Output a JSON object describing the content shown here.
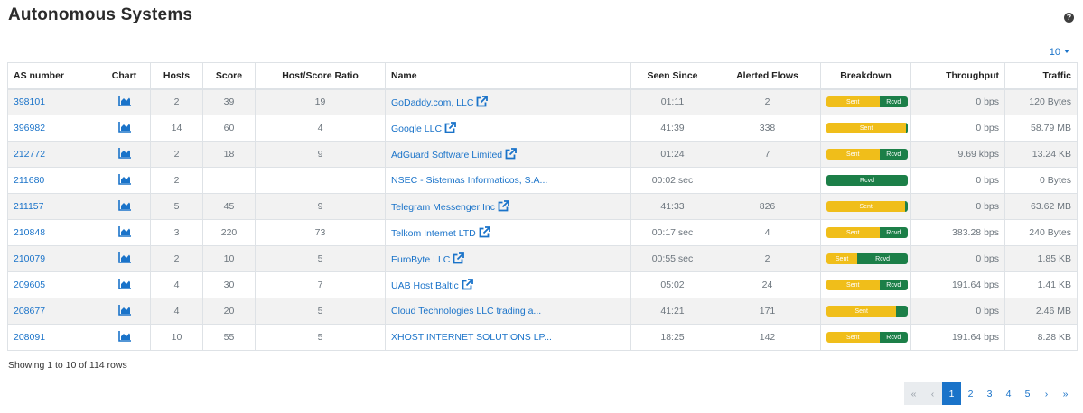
{
  "page": {
    "title": "Autonomous Systems",
    "help_icon": "question-circle-icon",
    "help_glyph": "?"
  },
  "page_size": {
    "value": "10"
  },
  "columns": {
    "as_number": "AS number",
    "chart": "Chart",
    "hosts": "Hosts",
    "score": "Score",
    "ratio": "Host/Score Ratio",
    "name": "Name",
    "seen_since": "Seen Since",
    "alerted_flows": "Alerted Flows",
    "breakdown": "Breakdown",
    "throughput": "Throughput",
    "traffic": "Traffic"
  },
  "colors": {
    "link": "#1a73c9",
    "sent": "#f0be1a",
    "rcvd": "#1c7f48",
    "chart_icon": "#1a73c9"
  },
  "breakdown_labels": {
    "sent": "Sent",
    "rcvd": "Rcvd"
  },
  "rows": [
    {
      "as_number": "398101",
      "hosts": "2",
      "score": "39",
      "ratio": "19",
      "name": "GoDaddy.com, LLC",
      "external": true,
      "seen_since": "01:11",
      "alerted_flows": "2",
      "sent_pct": 65,
      "throughput": "0 bps",
      "traffic": "120 Bytes"
    },
    {
      "as_number": "396982",
      "hosts": "14",
      "score": "60",
      "ratio": "4",
      "name": "Google LLC",
      "external": true,
      "seen_since": "41:39",
      "alerted_flows": "338",
      "sent_pct": 98,
      "throughput": "0 bps",
      "traffic": "58.79 MB"
    },
    {
      "as_number": "212772",
      "hosts": "2",
      "score": "18",
      "ratio": "9",
      "name": "AdGuard Software Limited",
      "external": true,
      "seen_since": "01:24",
      "alerted_flows": "7",
      "sent_pct": 65,
      "throughput": "9.69 kbps",
      "traffic": "13.24 KB"
    },
    {
      "as_number": "211680",
      "hosts": "2",
      "score": "",
      "ratio": "",
      "name": "NSEC - Sistemas Informaticos, S.A...",
      "external": false,
      "seen_since": "00:02 sec",
      "alerted_flows": "",
      "sent_pct": 0,
      "throughput": "0 bps",
      "traffic": "0 Bytes"
    },
    {
      "as_number": "211157",
      "hosts": "5",
      "score": "45",
      "ratio": "9",
      "name": "Telegram Messenger Inc",
      "external": true,
      "seen_since": "41:33",
      "alerted_flows": "826",
      "sent_pct": 97,
      "throughput": "0 bps",
      "traffic": "63.62 MB"
    },
    {
      "as_number": "210848",
      "hosts": "3",
      "score": "220",
      "ratio": "73",
      "name": "Telkom Internet LTD",
      "external": true,
      "seen_since": "00:17 sec",
      "alerted_flows": "4",
      "sent_pct": 65,
      "throughput": "383.28 bps",
      "traffic": "240 Bytes"
    },
    {
      "as_number": "210079",
      "hosts": "2",
      "score": "10",
      "ratio": "5",
      "name": "EuroByte LLC",
      "external": true,
      "seen_since": "00:55 sec",
      "alerted_flows": "2",
      "sent_pct": 38,
      "throughput": "0 bps",
      "traffic": "1.85 KB"
    },
    {
      "as_number": "209605",
      "hosts": "4",
      "score": "30",
      "ratio": "7",
      "name": "UAB Host Baltic",
      "external": true,
      "seen_since": "05:02",
      "alerted_flows": "24",
      "sent_pct": 65,
      "throughput": "191.64 bps",
      "traffic": "1.41 KB"
    },
    {
      "as_number": "208677",
      "hosts": "4",
      "score": "20",
      "ratio": "5",
      "name": "Cloud Technologies LLC trading a...",
      "external": false,
      "seen_since": "41:21",
      "alerted_flows": "171",
      "sent_pct": 86,
      "throughput": "0 bps",
      "traffic": "2.46 MB"
    },
    {
      "as_number": "208091",
      "hosts": "10",
      "score": "55",
      "ratio": "5",
      "name": "XHOST INTERNET SOLUTIONS LP...",
      "external": false,
      "seen_since": "18:25",
      "alerted_flows": "142",
      "sent_pct": 65,
      "throughput": "191.64 bps",
      "traffic": "8.28 KB"
    }
  ],
  "footer": {
    "rows_info": "Showing 1 to 10 of 114 rows"
  },
  "pagination": {
    "first": "«",
    "prev": "‹",
    "pages": [
      "1",
      "2",
      "3",
      "4",
      "5"
    ],
    "active_page": "1",
    "next": "›",
    "last": "»"
  }
}
